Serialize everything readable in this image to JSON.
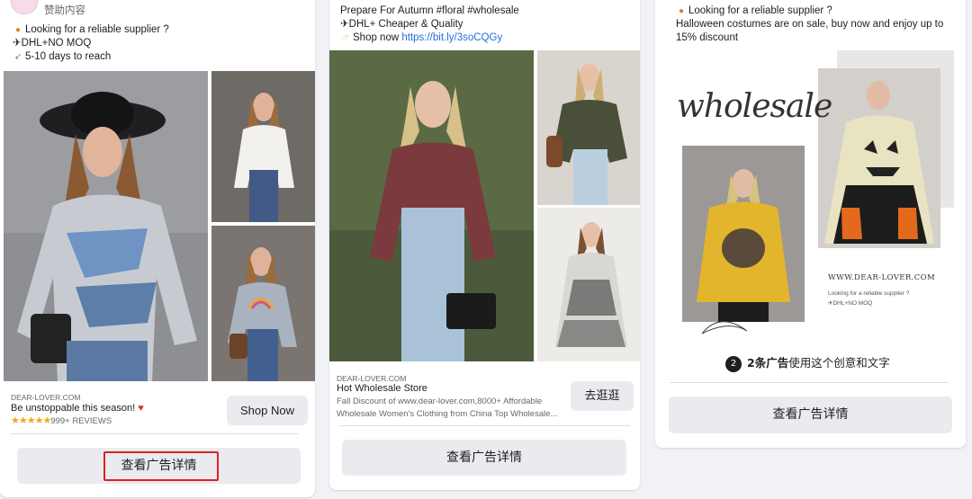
{
  "card1": {
    "sponsor_label": "赞助内容",
    "line1": "Looking for a reliable supplier ?",
    "line2": "✈DHL+NO MOQ",
    "line3": "5-10 days to reach",
    "site": "DEAR-LOVER.COM",
    "headline": "Be unstoppable this season!",
    "reviews": "999+ REVIEWS",
    "stars": 5,
    "cta": "Shop Now",
    "detail_button": "查看广告详情"
  },
  "card2": {
    "line1": "Prepare For Autumn #floral #wholesale",
    "line2": "✈DHL+ Cheaper & Quality",
    "line3_prefix": "Shop now ",
    "line3_link": "https://bit.ly/3soCQGy",
    "site": "DEAR-LOVER.COM",
    "headline": "Hot Wholesale Store",
    "desc1": "Fall Discount of www.dear-lover.com,8000+ Affordable",
    "desc2": "Wholesale Women's Clothing from China Top Wholesale...",
    "cta": "去逛逛",
    "detail_button": "查看广告详情"
  },
  "card3": {
    "line1": "Looking for a reliable supplier ?",
    "line2": "Halloween costumes are on sale, buy now and enjoy up to",
    "line3": "15% discount",
    "img_word": "wholesale",
    "img_site": "WWW.DEAR-LOVER.COM",
    "img_tag1": "Looking for a reliable supplier ?",
    "img_tag2": "✈DHL+NO MOQ",
    "versions_bold": "2条广告",
    "versions_rest": "使用这个创意和文字",
    "versions_count": "2",
    "detail_button": "查看广告详情"
  },
  "colors": {
    "page_bg": "#f0f2f5",
    "button_bg": "#e9ebee",
    "link": "#216fdb",
    "highlight": "#e02020"
  }
}
